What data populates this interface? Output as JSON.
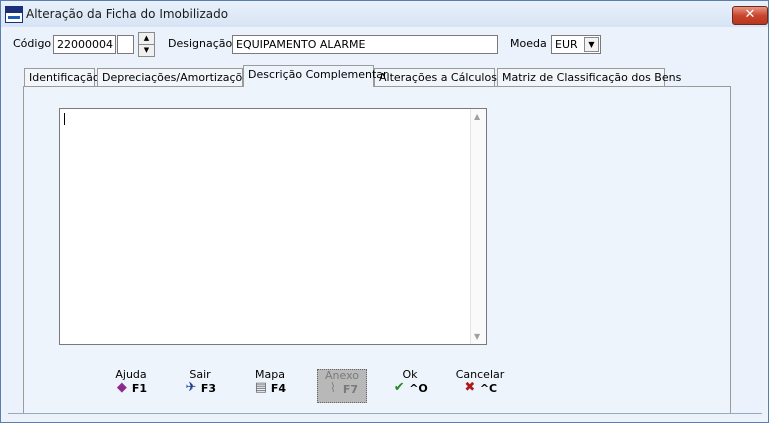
{
  "window": {
    "title": "Alteração da Ficha do Imobilizado",
    "close_label": "✕"
  },
  "header": {
    "codigo_label": "Código",
    "codigo_value": "22000004",
    "designacao_label": "Designação",
    "designacao_value": "EQUIPAMENTO ALARME",
    "moeda_label": "Moeda",
    "moeda_value": "EUR"
  },
  "tabs": [
    {
      "label": "Identificação"
    },
    {
      "label": "Depreciações/Amortizações"
    },
    {
      "label": "Descrição Complementar",
      "active": true
    },
    {
      "label": "Alterações a Cálculos..."
    },
    {
      "label": "Matriz de Classificação dos Bens"
    }
  ],
  "memo": {
    "value": ""
  },
  "buttons": {
    "ajuda": {
      "label": "Ajuda",
      "key": "F1",
      "icon": "help-book-icon"
    },
    "sair": {
      "label": "Sair",
      "key": "F3",
      "icon": "exit-person-icon"
    },
    "mapa": {
      "label": "Mapa",
      "key": "F4",
      "icon": "printer-icon"
    },
    "anexo": {
      "label": "Anexo",
      "key": "F7",
      "icon": "paperclip-icon",
      "disabled": true
    },
    "ok": {
      "label": "Ok",
      "key": "^O",
      "icon": "checkmark-icon"
    },
    "cancelar": {
      "label": "Cancelar",
      "key": "^C",
      "icon": "red-x-icon"
    }
  },
  "colors": {
    "title_bg": "#d7e4f4",
    "close": "#c9462d",
    "panel": "#eef4fc",
    "ok_green": "#1f8a1f",
    "cancel_red": "#b01818"
  }
}
